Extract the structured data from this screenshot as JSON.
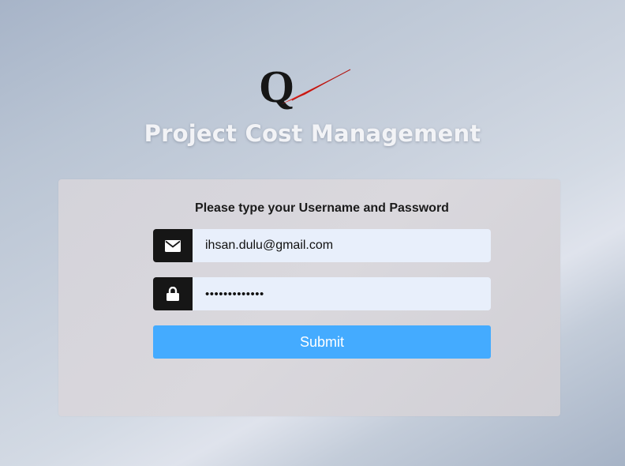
{
  "app": {
    "logo_letter": "Q",
    "title": "Project Cost Management"
  },
  "login": {
    "instructions": "Please type your Username and Password",
    "username": {
      "icon": "envelope-icon",
      "value": "ihsan.dulu@gmail.com"
    },
    "password": {
      "icon": "lock-icon",
      "value": "•••••••••••••"
    },
    "submit_label": "Submit"
  },
  "colors": {
    "input_background": "#e8effb",
    "icon_addon": "#161616",
    "submit_button": "#44abff",
    "logo_swoosh": "#e3231c"
  }
}
